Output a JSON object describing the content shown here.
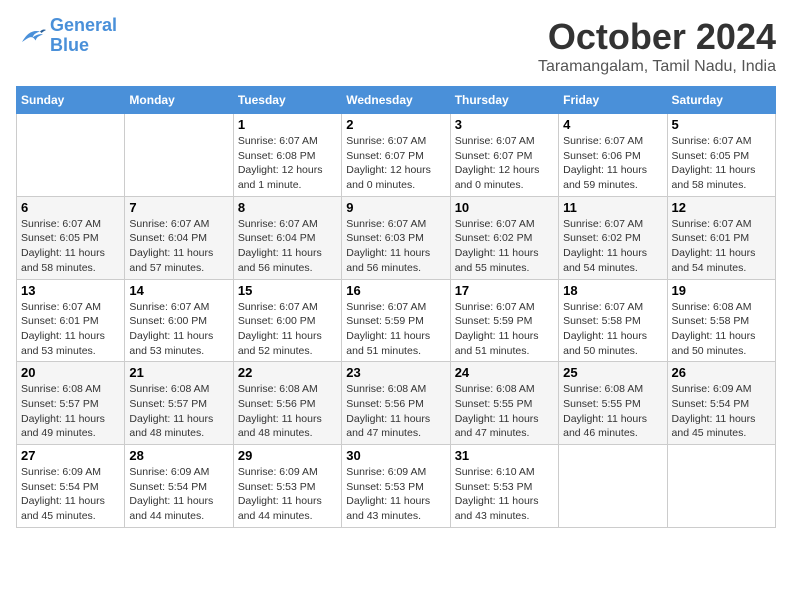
{
  "header": {
    "logo_line1": "General",
    "logo_line2": "Blue",
    "title": "October 2024",
    "location": "Taramangalam, Tamil Nadu, India"
  },
  "days_of_week": [
    "Sunday",
    "Monday",
    "Tuesday",
    "Wednesday",
    "Thursday",
    "Friday",
    "Saturday"
  ],
  "weeks": [
    [
      {
        "day": "",
        "info": ""
      },
      {
        "day": "",
        "info": ""
      },
      {
        "day": "1",
        "info": "Sunrise: 6:07 AM\nSunset: 6:08 PM\nDaylight: 12 hours\nand 1 minute."
      },
      {
        "day": "2",
        "info": "Sunrise: 6:07 AM\nSunset: 6:07 PM\nDaylight: 12 hours\nand 0 minutes."
      },
      {
        "day": "3",
        "info": "Sunrise: 6:07 AM\nSunset: 6:07 PM\nDaylight: 12 hours\nand 0 minutes."
      },
      {
        "day": "4",
        "info": "Sunrise: 6:07 AM\nSunset: 6:06 PM\nDaylight: 11 hours\nand 59 minutes."
      },
      {
        "day": "5",
        "info": "Sunrise: 6:07 AM\nSunset: 6:05 PM\nDaylight: 11 hours\nand 58 minutes."
      }
    ],
    [
      {
        "day": "6",
        "info": "Sunrise: 6:07 AM\nSunset: 6:05 PM\nDaylight: 11 hours\nand 58 minutes."
      },
      {
        "day": "7",
        "info": "Sunrise: 6:07 AM\nSunset: 6:04 PM\nDaylight: 11 hours\nand 57 minutes."
      },
      {
        "day": "8",
        "info": "Sunrise: 6:07 AM\nSunset: 6:04 PM\nDaylight: 11 hours\nand 56 minutes."
      },
      {
        "day": "9",
        "info": "Sunrise: 6:07 AM\nSunset: 6:03 PM\nDaylight: 11 hours\nand 56 minutes."
      },
      {
        "day": "10",
        "info": "Sunrise: 6:07 AM\nSunset: 6:02 PM\nDaylight: 11 hours\nand 55 minutes."
      },
      {
        "day": "11",
        "info": "Sunrise: 6:07 AM\nSunset: 6:02 PM\nDaylight: 11 hours\nand 54 minutes."
      },
      {
        "day": "12",
        "info": "Sunrise: 6:07 AM\nSunset: 6:01 PM\nDaylight: 11 hours\nand 54 minutes."
      }
    ],
    [
      {
        "day": "13",
        "info": "Sunrise: 6:07 AM\nSunset: 6:01 PM\nDaylight: 11 hours\nand 53 minutes."
      },
      {
        "day": "14",
        "info": "Sunrise: 6:07 AM\nSunset: 6:00 PM\nDaylight: 11 hours\nand 53 minutes."
      },
      {
        "day": "15",
        "info": "Sunrise: 6:07 AM\nSunset: 6:00 PM\nDaylight: 11 hours\nand 52 minutes."
      },
      {
        "day": "16",
        "info": "Sunrise: 6:07 AM\nSunset: 5:59 PM\nDaylight: 11 hours\nand 51 minutes."
      },
      {
        "day": "17",
        "info": "Sunrise: 6:07 AM\nSunset: 5:59 PM\nDaylight: 11 hours\nand 51 minutes."
      },
      {
        "day": "18",
        "info": "Sunrise: 6:07 AM\nSunset: 5:58 PM\nDaylight: 11 hours\nand 50 minutes."
      },
      {
        "day": "19",
        "info": "Sunrise: 6:08 AM\nSunset: 5:58 PM\nDaylight: 11 hours\nand 50 minutes."
      }
    ],
    [
      {
        "day": "20",
        "info": "Sunrise: 6:08 AM\nSunset: 5:57 PM\nDaylight: 11 hours\nand 49 minutes."
      },
      {
        "day": "21",
        "info": "Sunrise: 6:08 AM\nSunset: 5:57 PM\nDaylight: 11 hours\nand 48 minutes."
      },
      {
        "day": "22",
        "info": "Sunrise: 6:08 AM\nSunset: 5:56 PM\nDaylight: 11 hours\nand 48 minutes."
      },
      {
        "day": "23",
        "info": "Sunrise: 6:08 AM\nSunset: 5:56 PM\nDaylight: 11 hours\nand 47 minutes."
      },
      {
        "day": "24",
        "info": "Sunrise: 6:08 AM\nSunset: 5:55 PM\nDaylight: 11 hours\nand 47 minutes."
      },
      {
        "day": "25",
        "info": "Sunrise: 6:08 AM\nSunset: 5:55 PM\nDaylight: 11 hours\nand 46 minutes."
      },
      {
        "day": "26",
        "info": "Sunrise: 6:09 AM\nSunset: 5:54 PM\nDaylight: 11 hours\nand 45 minutes."
      }
    ],
    [
      {
        "day": "27",
        "info": "Sunrise: 6:09 AM\nSunset: 5:54 PM\nDaylight: 11 hours\nand 45 minutes."
      },
      {
        "day": "28",
        "info": "Sunrise: 6:09 AM\nSunset: 5:54 PM\nDaylight: 11 hours\nand 44 minutes."
      },
      {
        "day": "29",
        "info": "Sunrise: 6:09 AM\nSunset: 5:53 PM\nDaylight: 11 hours\nand 44 minutes."
      },
      {
        "day": "30",
        "info": "Sunrise: 6:09 AM\nSunset: 5:53 PM\nDaylight: 11 hours\nand 43 minutes."
      },
      {
        "day": "31",
        "info": "Sunrise: 6:10 AM\nSunset: 5:53 PM\nDaylight: 11 hours\nand 43 minutes."
      },
      {
        "day": "",
        "info": ""
      },
      {
        "day": "",
        "info": ""
      }
    ]
  ]
}
